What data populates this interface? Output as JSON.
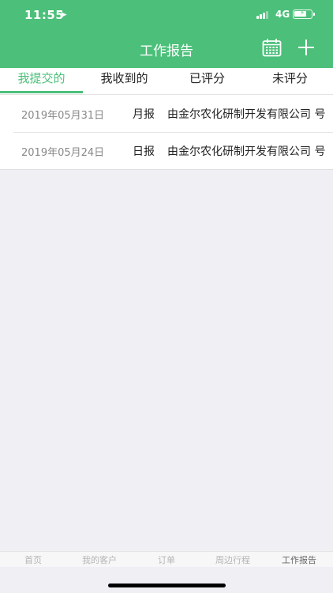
{
  "status_bar": {
    "time": "11:55",
    "network": "4G",
    "location_icon": "location-arrow-icon"
  },
  "navbar": {
    "title": "工作报告",
    "calendar_icon": "calendar-icon",
    "add_icon": "plus-icon"
  },
  "tabs": [
    {
      "label": "我提交的",
      "active": true
    },
    {
      "label": "我收到的",
      "active": false
    },
    {
      "label": "已评分",
      "active": false
    },
    {
      "label": "未评分",
      "active": false
    }
  ],
  "reports": [
    {
      "date": "2019年05月31日",
      "type": "月报",
      "company": "由金尔农化研制开发有限公司 号"
    },
    {
      "date": "2019年05月24日",
      "type": "日报",
      "company": "由金尔农化研制开发有限公司 号"
    }
  ],
  "tabbar": [
    {
      "label": "首页",
      "active": false
    },
    {
      "label": "我的客户",
      "active": false
    },
    {
      "label": "订单",
      "active": false
    },
    {
      "label": "周边行程",
      "active": false
    },
    {
      "label": "工作报告",
      "active": true
    }
  ],
  "colors": {
    "accent": "#4cc07a",
    "background": "#efeff4"
  }
}
